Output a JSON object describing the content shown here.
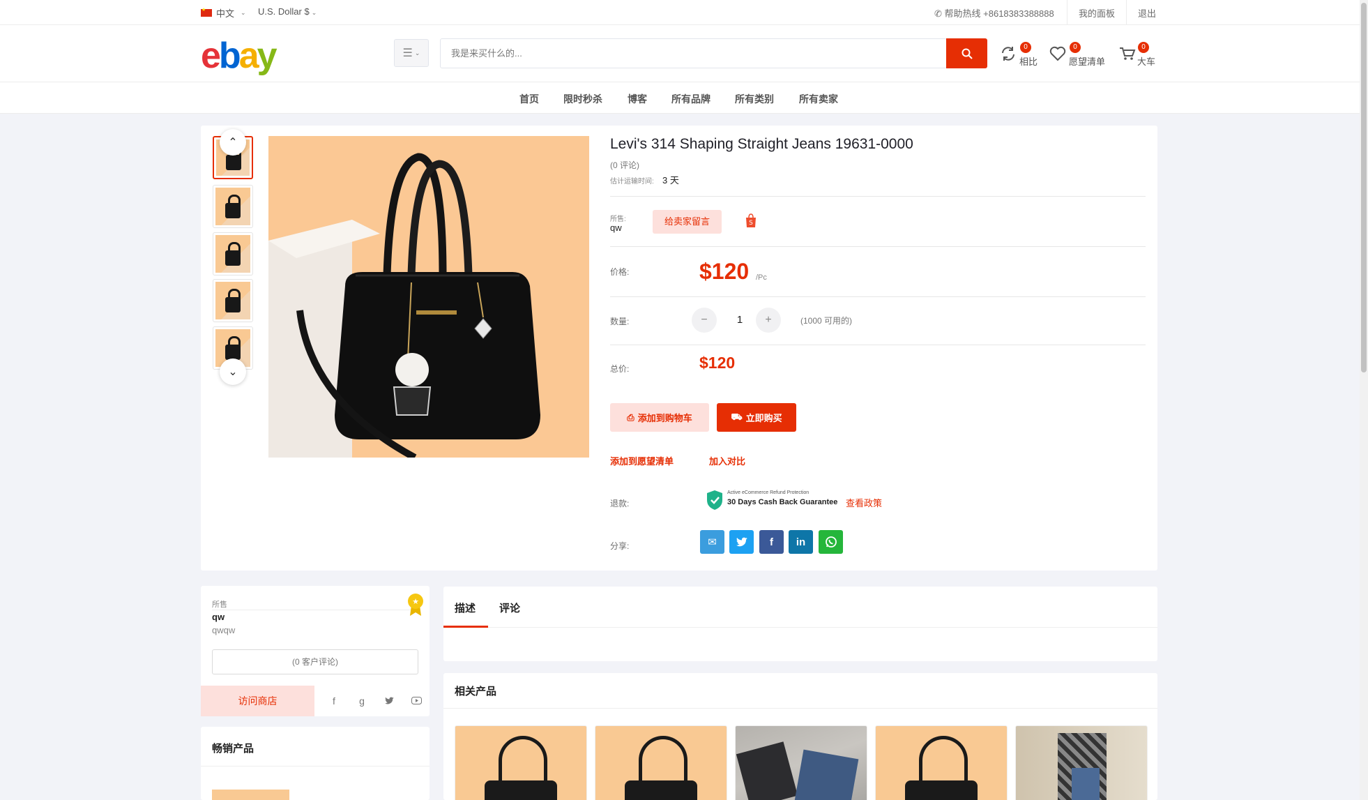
{
  "topbar": {
    "language": "中文",
    "currency": "U.S. Dollar $",
    "hotline": "帮助热线 +8618383388888",
    "dashboard": "我的面板",
    "logout": "退出"
  },
  "header": {
    "logo_letters": [
      "e",
      "b",
      "a",
      "y"
    ],
    "search_placeholder": "我是来买什么的...",
    "compare": {
      "label": "相比",
      "count": "0"
    },
    "wishlist": {
      "label": "愿望清单",
      "count": "0"
    },
    "cart": {
      "label": "大车",
      "count": "0"
    }
  },
  "nav": [
    "首页",
    "限时秒杀",
    "博客",
    "所有品牌",
    "所有类别",
    "所有卖家"
  ],
  "product": {
    "title": "Levi's 314 Shaping Straight Jeans 19631-0000",
    "reviews": "(0 评论)",
    "ship_label": "估计运输时间:",
    "ship_value": "3 天",
    "sold_label": "所售:",
    "sold_by": "qw",
    "message_seller": "给卖家留言",
    "price_label": "价格:",
    "price": "$120",
    "unit": "/Pc",
    "qty_label": "数量:",
    "qty_minus": "−",
    "qty": "1",
    "qty_plus": "+",
    "available": "(1000 可用的)",
    "total_label": "总价:",
    "total": "$120",
    "add_to_cart": "添加到购物车",
    "buy_now": "立即购买",
    "add_wishlist": "添加到愿望清单",
    "add_compare": "加入对比",
    "refund_label": "退款:",
    "refund_small": "Active eCommerce Refund Protection",
    "refund_big": "30 Days Cash Back Guarantee",
    "view_policy": "查看政策",
    "share_label": "分享:"
  },
  "seller": {
    "label": "所售",
    "name": "qw",
    "sub": "qwqw",
    "reviews": "(0 客户评论)",
    "visit": "访问商店"
  },
  "bestselling": {
    "title": "畅销产品"
  },
  "description": {
    "tab_desc": "描述",
    "tab_reviews": "评论"
  },
  "related": {
    "title": "相关产品"
  },
  "colors": {
    "accent": "#e62e04",
    "accent_soft": "#fde0dc"
  },
  "icons": {
    "share": [
      "email-icon",
      "twitter-icon",
      "facebook-icon",
      "linkedin-icon",
      "whatsapp-icon"
    ],
    "seller_social": [
      "facebook-icon",
      "google-icon",
      "twitter-icon",
      "youtube-icon"
    ]
  }
}
